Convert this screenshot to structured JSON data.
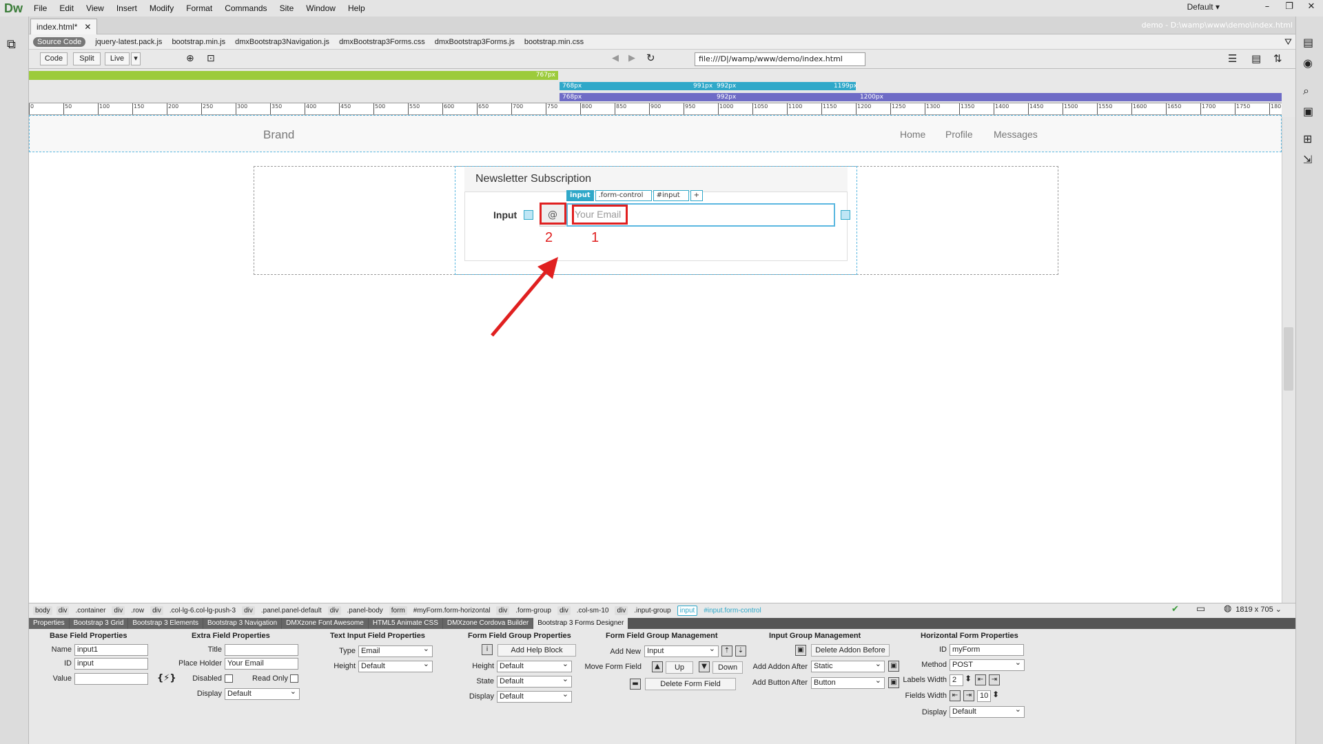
{
  "app": {
    "logo": "Dw",
    "workspace": "Default"
  },
  "menu": [
    "File",
    "Edit",
    "View",
    "Insert",
    "Modify",
    "Format",
    "Commands",
    "Site",
    "Window",
    "Help"
  ],
  "doc_tab": {
    "name": "index.html*",
    "path": "demo - D:\\wamp\\www\\demo\\index.html"
  },
  "related_files": [
    "Source Code",
    "jquery-latest.pack.js",
    "bootstrap.min.js",
    "dmxBootstrap3Navigation.js",
    "dmxBootstrap3Forms.css",
    "dmxBootstrap3Forms.js",
    "bootstrap.min.css"
  ],
  "toolbar": {
    "code": "Code",
    "split": "Split",
    "live": "Live",
    "url": "file:///D|/wamp/www/demo/index.html"
  },
  "media_queries": {
    "xs": "767px",
    "sm_min": "768px",
    "sm_max": "991px",
    "md_min": "992px",
    "md_max": "1199px",
    "md2_min": "992px",
    "lg_min": "1200px",
    "sm2_min": "768px"
  },
  "ruler": [
    "0",
    "50",
    "100",
    "150",
    "200",
    "250",
    "300",
    "350",
    "400",
    "450",
    "500",
    "550",
    "600",
    "650",
    "700",
    "750",
    "800",
    "850",
    "900",
    "950",
    "1000",
    "1050",
    "1100",
    "1150",
    "1200",
    "1250",
    "1300",
    "1350",
    "1400",
    "1450",
    "1500",
    "1550",
    "1600",
    "1650",
    "1700",
    "1750",
    "180"
  ],
  "page": {
    "brand": "Brand",
    "nav": [
      "Home",
      "Profile",
      "Messages"
    ],
    "panel_title": "Newsletter Subscription",
    "selection_tags": [
      "input",
      ".form-control",
      "#input",
      "+"
    ],
    "field_label": "Input",
    "addon": "@",
    "placeholder": "Your Email",
    "annotation_1": "1",
    "annotation_2": "2"
  },
  "breadcrumbs": [
    "body",
    "div",
    ".container",
    "div",
    ".row",
    "div",
    ".col-lg-6.col-lg-push-3",
    "div",
    ".panel.panel-default",
    "div",
    ".panel-body",
    "form",
    "#myForm.form-horizontal",
    "div",
    ".form-group",
    "div",
    ".col-sm-10",
    "div",
    ".input-group",
    "input",
    "#input.form-control"
  ],
  "window_size": "1819 x 705",
  "prop_tabs": [
    "Properties",
    "Bootstrap 3 Grid",
    "Bootstrap 3 Elements",
    "Bootstrap 3 Navigation",
    "DMXzone Font Awesome",
    "HTML5 Animate CSS",
    "DMXzone Cordova Builder",
    "Bootstrap 3 Forms Designer"
  ],
  "props": {
    "base": {
      "head": "Base Field Properties",
      "name_lbl": "Name",
      "name": "input1",
      "id_lbl": "ID",
      "id": "input",
      "value_lbl": "Value",
      "value": ""
    },
    "extra": {
      "head": "Extra Field Properties",
      "title_lbl": "Title",
      "title": "",
      "ph_lbl": "Place Holder",
      "ph": "Your Email",
      "disabled_lbl": "Disabled",
      "readonly_lbl": "Read Only",
      "display_lbl": "Display",
      "display": "Default"
    },
    "text": {
      "head": "Text Input Field Properties",
      "type_lbl": "Type",
      "type": "Email",
      "height_lbl": "Height",
      "height": "Default"
    },
    "group": {
      "head": "Form Field Group Properties",
      "help_btn": "Add Help Block",
      "height_lbl": "Height",
      "height": "Default",
      "state_lbl": "State",
      "state": "Default",
      "display_lbl": "Display",
      "display": "Default"
    },
    "mgmt": {
      "head": "Form Field Group Management",
      "add_lbl": "Add New",
      "add": "Input",
      "move_lbl": "Move Form Field",
      "up": "Up",
      "down": "Down",
      "delete": "Delete Form Field"
    },
    "ig": {
      "head": "Input Group Management",
      "delete_before": "Delete Addon Before",
      "after_lbl": "Add Addon After",
      "after": "Static",
      "btn_lbl": "Add Button After",
      "btn": "Button"
    },
    "hf": {
      "head": "Horizontal Form Properties",
      "id_lbl": "ID",
      "id": "myForm",
      "method_lbl": "Method",
      "method": "POST",
      "lw_lbl": "Labels Width",
      "lw": "2",
      "fw_lbl": "Fields Width",
      "fw": "10",
      "display_lbl": "Display",
      "display": "Default"
    }
  },
  "colors": {
    "xs_bar": "#9ccb3b",
    "sm_bar": "#2fa8c9",
    "lg_bar": "#6e6bc6",
    "annotation": "#e02020"
  }
}
